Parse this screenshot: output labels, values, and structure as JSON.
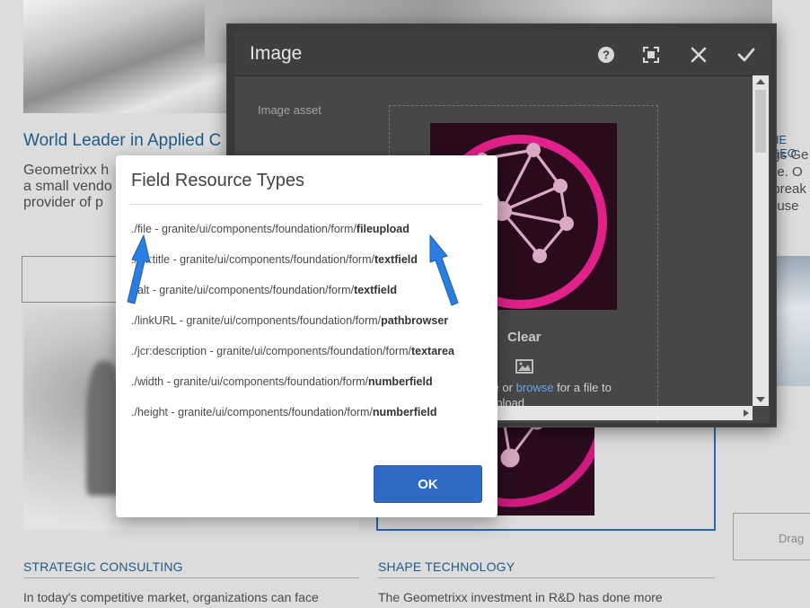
{
  "background": {
    "left_heading": "World Leader in Applied C",
    "left_text_lines": [
      "Geometrixx h",
      "a small vendo",
      "provider of p"
    ],
    "right_heading": "HE GEO",
    "right_text_lines": [
      "ngs Ge",
      "ere. O",
      "dbreak",
      "o-use"
    ],
    "drag_label": "Drag",
    "section_left_title": "STRATEGIC CONSULTING",
    "section_left_text": "In today's competitive market, organizations can face",
    "section_right_title": "SHAPE TECHNOLOGY",
    "section_right_text": "The Geometrixx investment in R&D has done more"
  },
  "image_dialog": {
    "title": "Image",
    "field_label": "Image asset",
    "clear_label": "Clear",
    "drop_prefix": "ere or ",
    "browse_link": "browse",
    "drop_suffix": " for a file to",
    "drop_line2": "upload",
    "icons": {
      "help": "help-icon",
      "fullscreen": "fullscreen-icon",
      "close": "close-icon",
      "done": "checkmark-icon"
    }
  },
  "frt_dialog": {
    "title": "Field Resource Types",
    "rows": [
      {
        "prefix": "./file - granite/ui/components/foundation/form/",
        "type": "fileupload"
      },
      {
        "prefix": "./jcr:title - granite/ui/components/foundation/form/",
        "type": "textfield"
      },
      {
        "prefix": "./alt - granite/ui/components/foundation/form/",
        "type": "textfield"
      },
      {
        "prefix": "./linkURL - granite/ui/components/foundation/form/",
        "type": "pathbrowser"
      },
      {
        "prefix": "./jcr:description - granite/ui/components/foundation/form/",
        "type": "textarea"
      },
      {
        "prefix": "./width - granite/ui/components/foundation/form/",
        "type": "numberfield"
      },
      {
        "prefix": "./height - granite/ui/components/foundation/form/",
        "type": "numberfield"
      }
    ],
    "ok_label": "OK"
  },
  "colors": {
    "accent_blue": "#2f6ac4",
    "arrow_blue": "#2a7de1",
    "logo_magenta": "#e0218a"
  }
}
